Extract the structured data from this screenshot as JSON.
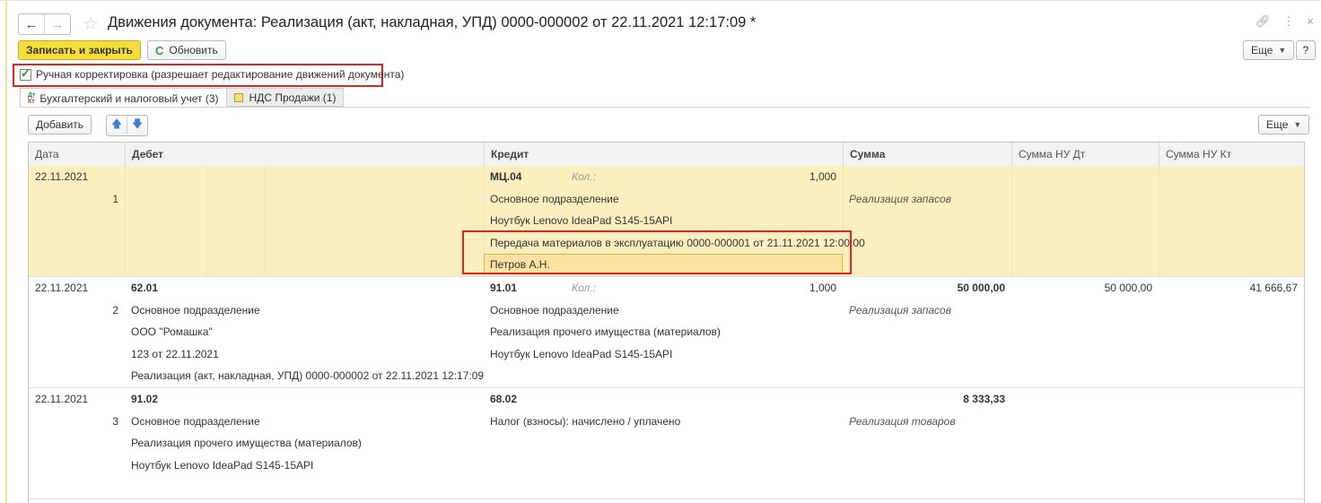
{
  "window": {
    "title": "Движения документа: Реализация (акт, накладная, УПД) 0000-000002 от 22.11.2021 12:17:09 *",
    "back_icon": "←",
    "forward_icon": "→",
    "link_icon": "🔗",
    "more_icon": "⋮",
    "close_icon": "×"
  },
  "toolbar": {
    "save_close_label": "Записать и закрыть",
    "refresh_label": "Обновить",
    "more_label": "Еще",
    "help_label": "?"
  },
  "manual_correction": {
    "checked": true,
    "label": "Ручная корректировка (разрешает редактирование движений документа)"
  },
  "tabs": [
    {
      "label": "Бухгалтерский и налоговый учет (3)",
      "icon_top": "Дт",
      "icon_bottom": "Кт"
    },
    {
      "label": "НДС Продажи (1)"
    }
  ],
  "table_toolbar": {
    "add_label": "Добавить",
    "up_icon": "🡅",
    "down_icon": "🡇",
    "more_label": "Еще"
  },
  "table": {
    "columns": [
      "Дата",
      "Дебет",
      "Кредит",
      "Сумма",
      "Сумма НУ Дт",
      "Сумма НУ Кт"
    ],
    "records": [
      {
        "date": "22.11.2021",
        "num": "1",
        "debit_account": "",
        "debit_lines": [],
        "credit_account": "МЦ.04",
        "credit_qty_label": "Кол.:",
        "credit_qty": "1,000",
        "credit_lines": [
          "Основное подразделение",
          "Ноутбук Lenovo IdeaPad S145-15API",
          "Передача материалов в эксплуатацию 0000-000001 от 21.11.2021 12:00:00",
          "Петров А.Н."
        ],
        "amount": "",
        "content": "Реализация запасов",
        "nu_dt": "",
        "nu_kt": ""
      },
      {
        "date": "22.11.2021",
        "num": "2",
        "debit_account": "62.01",
        "debit_lines": [
          "Основное подразделение",
          "ООО \"Ромашка\"",
          "123 от 22.11.2021",
          "Реализация (акт, накладная, УПД) 0000-000002 от 22.11.2021 12:17:09"
        ],
        "credit_account": "91.01",
        "credit_qty_label": "Кол.:",
        "credit_qty": "1,000",
        "credit_lines": [
          "Основное подразделение",
          "Реализация прочего имущества (материалов)",
          "Ноутбук Lenovo IdeaPad S145-15API"
        ],
        "amount": "50 000,00",
        "content": "Реализация запасов",
        "nu_dt": "50 000,00",
        "nu_kt": "41 666,67"
      },
      {
        "date": "22.11.2021",
        "num": "3",
        "debit_account": "91.02",
        "debit_lines": [
          "Основное подразделение",
          "Реализация прочего имущества (материалов)",
          "Ноутбук Lenovo IdeaPad S145-15API"
        ],
        "credit_account": "68.02",
        "credit_qty_label": "",
        "credit_qty": "",
        "credit_lines": [
          "Налог (взносы): начислено / уплачено"
        ],
        "amount": "8 333,33",
        "content": "Реализация товаров",
        "nu_dt": "",
        "nu_kt": ""
      }
    ]
  },
  "colors": {
    "accent_yellow": "#f8de3a",
    "selected_row": "#fcefbf",
    "highlight_red": "#e32222"
  }
}
